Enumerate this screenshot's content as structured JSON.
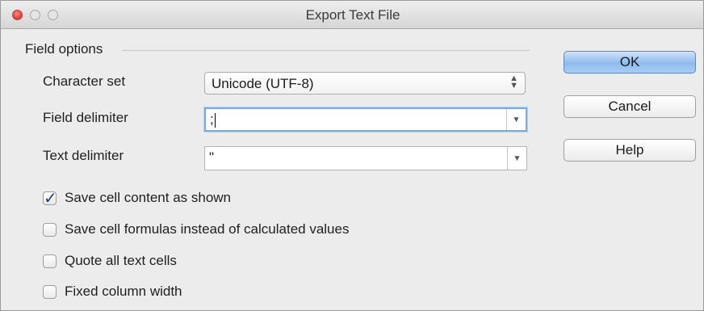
{
  "window": {
    "title": "Export Text File"
  },
  "field_options": {
    "group_label": "Field options",
    "character_set": {
      "label": "Character set",
      "value": "Unicode (UTF-8)"
    },
    "field_delimiter": {
      "label": "Field delimiter",
      "value": ";"
    },
    "text_delimiter": {
      "label": "Text delimiter",
      "value": "\""
    }
  },
  "checkboxes": {
    "save_as_shown": {
      "label": "Save cell content as shown",
      "checked": true
    },
    "save_formulas": {
      "label": "Save cell formulas instead of calculated values",
      "checked": false
    },
    "quote_all": {
      "label": "Quote all text cells",
      "checked": false
    },
    "fixed_width": {
      "label": "Fixed column width",
      "checked": false
    }
  },
  "buttons": {
    "ok": "OK",
    "cancel": "Cancel",
    "help": "Help"
  },
  "colors": {
    "default_button": "#8fbbec",
    "focus_ring": "#7aa9e6",
    "window_bg": "#ececec"
  }
}
